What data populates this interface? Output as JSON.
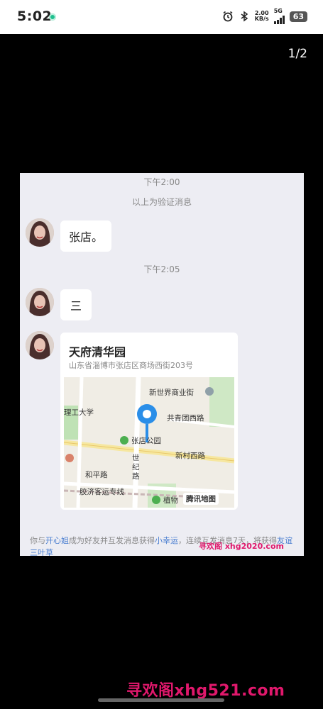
{
  "status_bar": {
    "time": "5:02",
    "net_speed_top": "2.00",
    "net_speed_bottom": "KB/s",
    "network": "5G",
    "battery": "63"
  },
  "viewer": {
    "counter": "1/2"
  },
  "chat": {
    "time_1": "下午2:00",
    "system_message": "以上为验证消息",
    "message_1": "张店。",
    "time_2": "下午2:05",
    "message_2": "三",
    "location": {
      "title": "天府清华园",
      "address": "山东省淄博市张店区商场西街203号",
      "map_labels": {
        "l1": "新世界商业街",
        "l2": "理工大学",
        "l3": "共青团西路",
        "l4": "张店公园",
        "l5": "新村西路",
        "l6": "世纪路",
        "l7": "和平路",
        "l8": "胶济客运专线",
        "l9": "植物",
        "brand": "腾讯地图"
      }
    },
    "bottom_note": {
      "p1": "你与",
      "name": "开心姐",
      "p2": "成为好友并互发消息获得",
      "link1": "小幸运",
      "p3": "，连续互发消息7天，将获得",
      "link2": "友谊三叶草"
    },
    "inner_watermark": "寻欢阁 xhg2020.com"
  },
  "watermark": "寻欢阁xhg521.com"
}
